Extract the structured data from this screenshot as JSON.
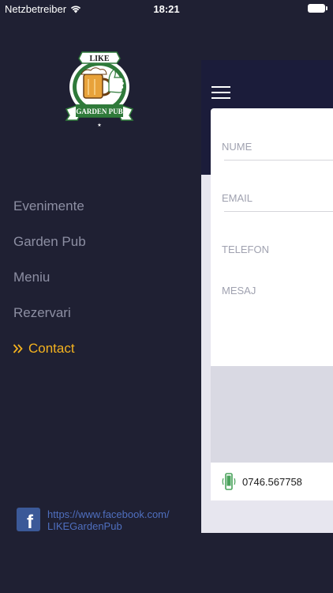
{
  "status_bar": {
    "carrier": "Netzbetreiber",
    "time": "18:21"
  },
  "logo": {
    "top_text": "LIKE",
    "banner_text": "GARDEN PUB"
  },
  "menu": {
    "items": [
      {
        "label": "Evenimente",
        "active": false
      },
      {
        "label": "Garden Pub",
        "active": false
      },
      {
        "label": "Meniu",
        "active": false
      },
      {
        "label": "Rezervari",
        "active": false
      },
      {
        "label": "Contact",
        "active": true
      }
    ]
  },
  "facebook": {
    "icon_letter": "f",
    "line1": "https://www.facebook.com/",
    "line2": "LIKEGardenPub"
  },
  "form": {
    "name_placeholder": "NUME",
    "email_placeholder": "EMAIL",
    "phone_placeholder": "TELEFON",
    "message_placeholder": "MESAJ"
  },
  "contact": {
    "phone_number": "0746.567758"
  },
  "colors": {
    "sidebar_bg": "#1f2033",
    "accent": "#f4b21f",
    "menu_text": "#8d8fa3",
    "navbar": "#1b1c3a",
    "facebook": "#3b5998"
  }
}
